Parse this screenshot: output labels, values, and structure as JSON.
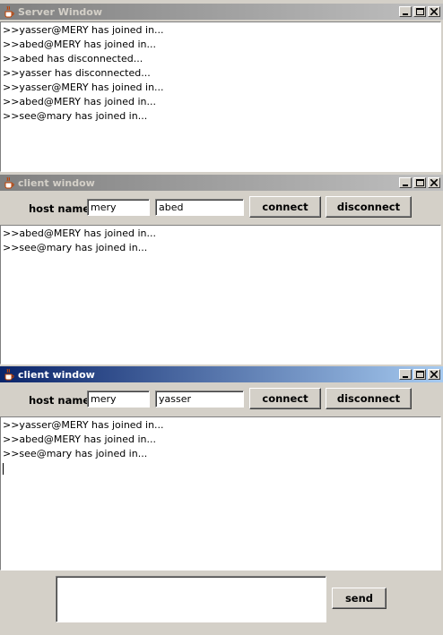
{
  "server": {
    "title": "Server Window",
    "lines": [
      ">>yasser@MERY has joined in...",
      ">>abed@MERY has joined in...",
      ">>abed has disconnected...",
      ">>yasser has disconnected...",
      ">>yasser@MERY has joined in...",
      ">>abed@MERY has joined in...",
      ">>see@mary has joined in..."
    ]
  },
  "client1": {
    "title": "client window",
    "host_label": "host name",
    "host_value": "mery",
    "user_value": "abed",
    "connect_label": "connect",
    "disconnect_label": "disconnect",
    "lines": [
      ">>abed@MERY has joined in...",
      ">>see@mary has joined in..."
    ]
  },
  "client2": {
    "title": "client window",
    "host_label": "host name",
    "host_value": "mery",
    "user_value": "yasser",
    "connect_label": "connect",
    "disconnect_label": "disconnect",
    "lines": [
      ">>yasser@MERY has joined in...",
      ">>abed@MERY has joined in...",
      ">>see@mary has joined in..."
    ],
    "message_value": "",
    "send_label": "send"
  }
}
